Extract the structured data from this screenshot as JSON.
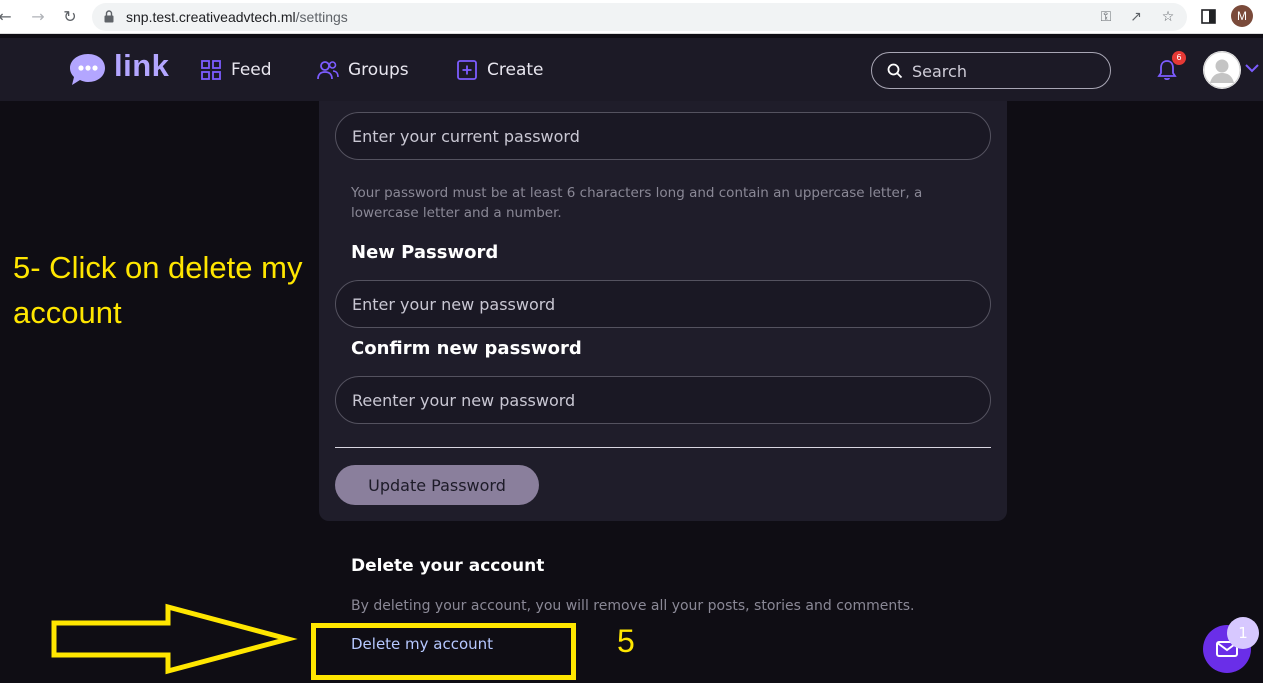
{
  "browser": {
    "url_host": "snp.test.creativeadvtech.ml",
    "url_path": "/settings",
    "profile_initial": "M"
  },
  "header": {
    "logo_text": "link",
    "nav": [
      {
        "label": "Feed",
        "icon": "grid-icon"
      },
      {
        "label": "Groups",
        "icon": "users-icon"
      },
      {
        "label": "Create",
        "icon": "plus-square-icon"
      }
    ],
    "search_placeholder": "Search",
    "notification_count": "6"
  },
  "password_form": {
    "current_placeholder": "Enter your current password",
    "hint": "Your password must be at least 6 characters long and contain an uppercase letter, a lowercase letter and a number.",
    "new_label": "New Password",
    "new_placeholder": "Enter your new password",
    "confirm_label": "Confirm new password",
    "confirm_placeholder": "Reenter your new password",
    "update_button": "Update Password"
  },
  "delete_section": {
    "title": "Delete your account",
    "description": "By deleting your account, you will remove all your posts, stories and comments.",
    "link": "Delete my account"
  },
  "annotation": {
    "instruction": "5- Click on delete my account",
    "step_number": "5"
  },
  "chat": {
    "badge": "1"
  },
  "colors": {
    "accent": "#6a2ee8",
    "logo": "#b3a6ff",
    "annotation": "#ffe600",
    "background": "#0f0d14",
    "card": "#1f1d2a"
  }
}
